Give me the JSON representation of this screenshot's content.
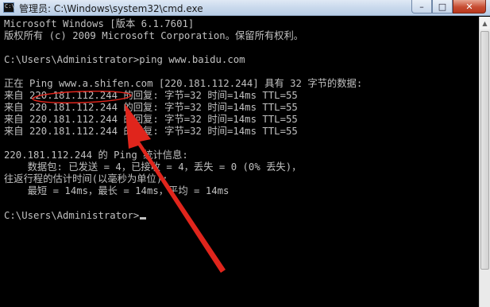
{
  "window": {
    "title": "管理员: C:\\Windows\\system32\\cmd.exe",
    "minimize_label": "–",
    "maximize_label": "□",
    "close_label": "✕"
  },
  "console": {
    "lines": [
      "Microsoft Windows [版本 6.1.7601]",
      "版权所有 (c) 2009 Microsoft Corporation。保留所有权利。",
      "",
      "C:\\Users\\Administrator>ping www.baidu.com",
      "",
      "正在 Ping www.a.shifen.com [220.181.112.244] 具有 32 字节的数据:",
      "来自 220.181.112.244 的回复: 字节=32 时间=14ms TTL=55",
      "来自 220.181.112.244 的回复: 字节=32 时间=14ms TTL=55",
      "来自 220.181.112.244 的回复: 字节=32 时间=14ms TTL=55",
      "来自 220.181.112.244 的回复: 字节=32 时间=14ms TTL=55",
      "",
      "220.181.112.244 的 Ping 统计信息:",
      "    数据包: 已发送 = 4，已接收 = 4，丢失 = 0 (0% 丢失)，",
      "往返行程的估计时间(以毫秒为单位):",
      "    最短 = 14ms，最长 = 14ms，平均 = 14ms",
      "",
      "C:\\Users\\Administrator>"
    ]
  },
  "annotation": {
    "color": "#e0251c"
  }
}
